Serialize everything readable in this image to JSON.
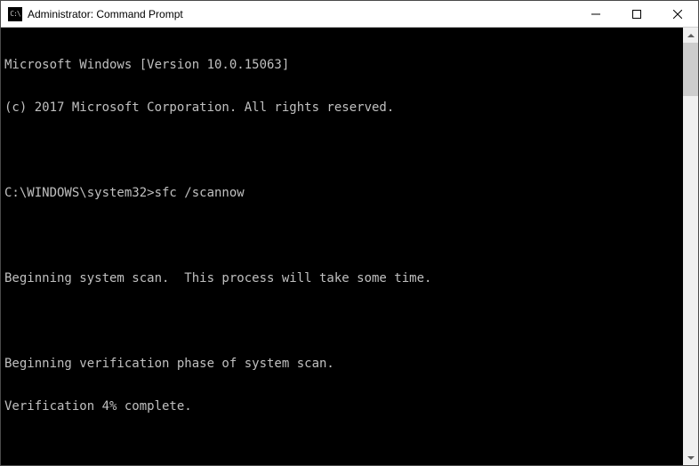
{
  "titlebar": {
    "title": "Administrator: Command Prompt"
  },
  "terminal": {
    "lines": [
      "Microsoft Windows [Version 10.0.15063]",
      "(c) 2017 Microsoft Corporation. All rights reserved.",
      "",
      "C:\\WINDOWS\\system32>sfc /scannow",
      "",
      "Beginning system scan.  This process will take some time.",
      "",
      "Beginning verification phase of system scan.",
      "Verification 4% complete."
    ]
  }
}
